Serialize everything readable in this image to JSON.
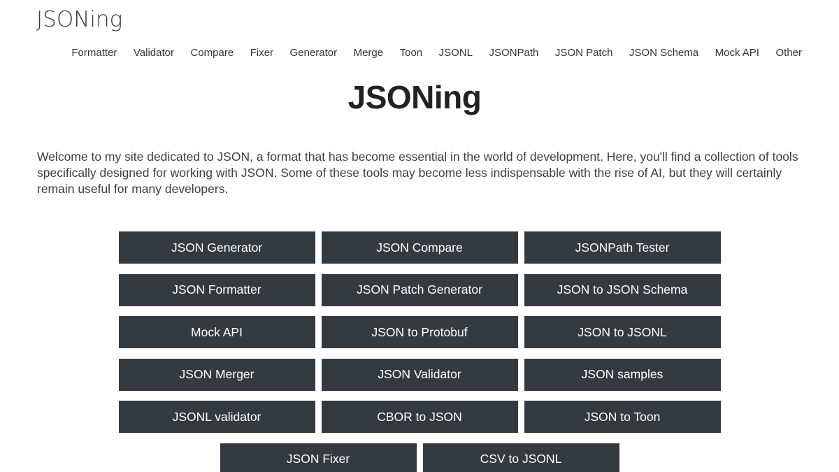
{
  "site": {
    "logo": "JSONing"
  },
  "nav": {
    "items": [
      {
        "label": "Formatter"
      },
      {
        "label": "Validator"
      },
      {
        "label": "Compare"
      },
      {
        "label": "Fixer"
      },
      {
        "label": "Generator"
      },
      {
        "label": "Merge"
      },
      {
        "label": "Toon"
      },
      {
        "label": "JSONL"
      },
      {
        "label": "JSONPath"
      },
      {
        "label": "JSON Patch"
      },
      {
        "label": "JSON Schema"
      },
      {
        "label": "Mock API"
      },
      {
        "label": "Other"
      }
    ]
  },
  "main": {
    "title": "JSONing",
    "intro": "Welcome to my site dedicated to JSON, a format that has become essential in the world of development. Here, you'll find a collection of tools specifically designed for working with JSON. Some of these tools may become less indispensable with the rise of AI, but they will certainly remain useful for many developers."
  },
  "tools": [
    {
      "label": "JSON Generator"
    },
    {
      "label": "JSON Compare"
    },
    {
      "label": "JSONPath Tester"
    },
    {
      "label": "JSON Formatter"
    },
    {
      "label": "JSON Patch Generator"
    },
    {
      "label": "JSON to JSON Schema"
    },
    {
      "label": "Mock API"
    },
    {
      "label": "JSON to Protobuf"
    },
    {
      "label": "JSON to JSONL"
    },
    {
      "label": "JSON Merger"
    },
    {
      "label": "JSON Validator"
    },
    {
      "label": "JSON samples"
    },
    {
      "label": "JSONL validator"
    },
    {
      "label": "CBOR to JSON"
    },
    {
      "label": "JSON to Toon"
    },
    {
      "label": "JSON Fixer"
    },
    {
      "label": "CSV to JSONL"
    }
  ],
  "colors": {
    "button_bg": "#343a40",
    "button_text": "#ffffff",
    "text": "#333333"
  }
}
